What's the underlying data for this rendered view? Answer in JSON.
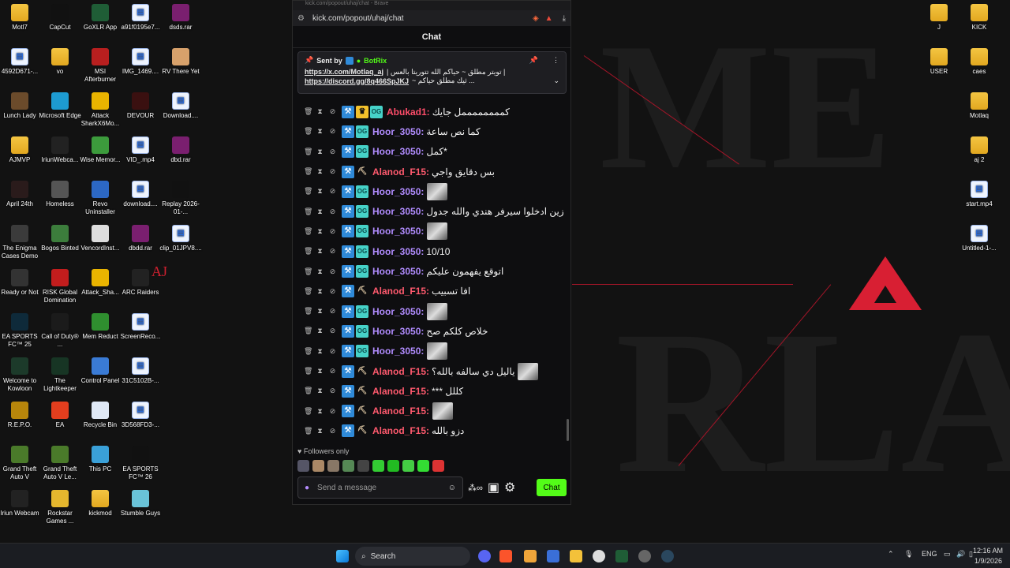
{
  "desktop": {
    "left_icons": [
      {
        "label": "Motl7",
        "kind": "folder"
      },
      {
        "label": "CapCut",
        "kind": "app",
        "color": "#111111"
      },
      {
        "label": "GoXLR App",
        "kind": "app",
        "color": "#1f5d36"
      },
      {
        "label": "a91f0195e7...",
        "kind": "file"
      },
      {
        "label": "dsds.rar",
        "kind": "app",
        "color": "#7a1f6f"
      },
      {
        "label": "4592D671-...",
        "kind": "file"
      },
      {
        "label": "vo",
        "kind": "folder"
      },
      {
        "label": "MSI Afterburner",
        "kind": "app",
        "color": "#b81f1f"
      },
      {
        "label": "IMG_1469....",
        "kind": "file"
      },
      {
        "label": "RV There Yet",
        "kind": "app",
        "color": "#d7a16b"
      },
      {
        "label": "Lunch Lady",
        "kind": "app",
        "color": "#6b4b2b"
      },
      {
        "label": "Microsoft Edge",
        "kind": "app",
        "color": "#1d9bd1"
      },
      {
        "label": "Attack SharkX6Mo...",
        "kind": "app",
        "color": "#e9b400"
      },
      {
        "label": "DEVOUR",
        "kind": "app",
        "color": "#3a1010"
      },
      {
        "label": "Download....",
        "kind": "file"
      },
      {
        "label": "AJMVP",
        "kind": "folder"
      },
      {
        "label": "IriunWebca...",
        "kind": "app",
        "color": "#222222"
      },
      {
        "label": "Wise Memor...",
        "kind": "app",
        "color": "#3c9b3c"
      },
      {
        "label": "VID_.mp4",
        "kind": "file"
      },
      {
        "label": "dbd.rar",
        "kind": "app",
        "color": "#7a1f6f"
      },
      {
        "label": "April 24th",
        "kind": "app",
        "color": "#2a1b1b"
      },
      {
        "label": "Homeless",
        "kind": "app",
        "color": "#555555"
      },
      {
        "label": "Revo Uninstaller",
        "kind": "app",
        "color": "#2c68c4"
      },
      {
        "label": "download....",
        "kind": "file"
      },
      {
        "label": "Replay 2026-01-...",
        "kind": "app",
        "color": "#111111"
      },
      {
        "label": "The Enigma Cases Demo",
        "kind": "app",
        "color": "#3b3b3b"
      },
      {
        "label": "Bogos Binted",
        "kind": "app",
        "color": "#3c7d3c"
      },
      {
        "label": "VencordInst...",
        "kind": "app",
        "color": "#dddddd"
      },
      {
        "label": "dbdd.rar",
        "kind": "app",
        "color": "#7a1f6f"
      },
      {
        "label": "clip_01JPV8....",
        "kind": "file"
      },
      {
        "label": "Ready or Not",
        "kind": "app",
        "color": "#333333"
      },
      {
        "label": "RISK Global Domination",
        "kind": "app",
        "color": "#c21d1d"
      },
      {
        "label": "Attack_Sha...",
        "kind": "app",
        "color": "#e9b400"
      },
      {
        "label": "ARC Raiders",
        "kind": "app",
        "color": "#222222"
      },
      {
        "label": "",
        "kind": "none"
      },
      {
        "label": "EA SPORTS FC™ 25",
        "kind": "app",
        "color": "#0e2a3a"
      },
      {
        "label": "Call of Duty® ...",
        "kind": "app",
        "color": "#1b1b1b"
      },
      {
        "label": "Mem Reduct",
        "kind": "app",
        "color": "#2f8f2f"
      },
      {
        "label": "ScreenReco...",
        "kind": "file"
      },
      {
        "label": "",
        "kind": "none"
      },
      {
        "label": "Welcome to Kowloon",
        "kind": "app",
        "color": "#1c3a2a"
      },
      {
        "label": "The Lightkeeper",
        "kind": "app",
        "color": "#173524"
      },
      {
        "label": "Control Panel",
        "kind": "app",
        "color": "#3a7bd5"
      },
      {
        "label": "31C5102B-...",
        "kind": "file"
      },
      {
        "label": "",
        "kind": "none"
      },
      {
        "label": "R.E.P.O.",
        "kind": "app",
        "color": "#b8860b"
      },
      {
        "label": "EA",
        "kind": "app",
        "color": "#e33e1e"
      },
      {
        "label": "Recycle Bin",
        "kind": "app",
        "color": "#dfe8f5"
      },
      {
        "label": "3D568FD3-...",
        "kind": "file"
      },
      {
        "label": "",
        "kind": "none"
      },
      {
        "label": "Grand Theft Auto V",
        "kind": "app",
        "color": "#4a7a2a"
      },
      {
        "label": "Grand Theft Auto V Le...",
        "kind": "app",
        "color": "#4a7a2a"
      },
      {
        "label": "This PC",
        "kind": "app",
        "color": "#3aa0d8"
      },
      {
        "label": "EA SPORTS FC™ 26",
        "kind": "app",
        "color": "#111111"
      },
      {
        "label": "",
        "kind": "none"
      },
      {
        "label": "Iriun Webcam",
        "kind": "app",
        "color": "#222222"
      },
      {
        "label": "Rockstar Games ...",
        "kind": "app",
        "color": "#e5b72e"
      },
      {
        "label": "kickmod",
        "kind": "folder"
      },
      {
        "label": "Stumble Guys",
        "kind": "app",
        "color": "#69c3d8"
      },
      {
        "label": "",
        "kind": "none"
      }
    ],
    "right_icons": [
      {
        "label": "J",
        "kind": "folder"
      },
      {
        "label": "KICK",
        "kind": "folder"
      },
      {
        "label": "USER",
        "kind": "folder"
      },
      {
        "label": "caes",
        "kind": "folder"
      },
      {
        "label": "",
        "kind": "none"
      },
      {
        "label": "Motlaq",
        "kind": "folder"
      },
      {
        "label": "",
        "kind": "none"
      },
      {
        "label": "aj 2",
        "kind": "folder"
      },
      {
        "label": "",
        "kind": "none"
      },
      {
        "label": "start.mp4",
        "kind": "file"
      },
      {
        "label": "",
        "kind": "none"
      },
      {
        "label": "Untitled-1-...",
        "kind": "file"
      }
    ],
    "wallpaper_mark": "AJ"
  },
  "browser": {
    "title": "kick.com/popout/uhaj/chat - Brave",
    "url": "kick.com/popout/uhaj/chat"
  },
  "chat": {
    "header": "Chat",
    "pinned": {
      "sent_by": "Sent by",
      "bot": "BotRix",
      "line1_link": "https://x.com/Motlaq_aj",
      "line1_text": "| تويتر مطلق ~ حياكم الله تتوريتا بالعس |",
      "line2_link": "https://discord.gg/8q466SpJKJ",
      "line2_text": "~ ثيك مطلق حياكم ..."
    },
    "messages": [
      {
        "user": "Abukad1",
        "color": "#ff4d6a",
        "badges": [
          "mod",
          "crown",
          "og"
        ],
        "text": "كممممممممل جايك"
      },
      {
        "user": "Hoor_3050",
        "color": "#b18cff",
        "badges": [
          "mod",
          "og"
        ],
        "text": "كما نص ساعة"
      },
      {
        "user": "Hoor_3050",
        "color": "#b18cff",
        "badges": [
          "mod",
          "og"
        ],
        "text": "كمل*"
      },
      {
        "user": "Alanod_F15",
        "color": "#ff5a6e",
        "badges": [
          "mod",
          "pick"
        ],
        "text": "بس دقايق واجي"
      },
      {
        "user": "Hoor_3050",
        "color": "#b18cff",
        "badges": [
          "mod",
          "og"
        ],
        "text": "",
        "thumb": true
      },
      {
        "user": "Hoor_3050",
        "color": "#b18cff",
        "badges": [
          "mod",
          "og"
        ],
        "text": "زين ادخلوا سيرفر هندي والله جدول"
      },
      {
        "user": "Hoor_3050",
        "color": "#b18cff",
        "badges": [
          "mod",
          "og"
        ],
        "text": "",
        "thumb": true
      },
      {
        "user": "Hoor_3050",
        "color": "#b18cff",
        "badges": [
          "mod",
          "og"
        ],
        "text": "10/10"
      },
      {
        "user": "Hoor_3050",
        "color": "#b18cff",
        "badges": [
          "mod",
          "og"
        ],
        "text": "اتوقع يفهمون عليكم"
      },
      {
        "user": "Alanod_F15",
        "color": "#ff5a6e",
        "badges": [
          "mod",
          "pick"
        ],
        "text": "افا تسبيب"
      },
      {
        "user": "Hoor_3050",
        "color": "#b18cff",
        "badges": [
          "mod",
          "og"
        ],
        "text": "",
        "thumb": true
      },
      {
        "user": "Hoor_3050",
        "color": "#b18cff",
        "badges": [
          "mod",
          "og"
        ],
        "text": "خلاص كلكم صح"
      },
      {
        "user": "Hoor_3050",
        "color": "#b18cff",
        "badges": [
          "mod",
          "og"
        ],
        "text": "",
        "thumb": true
      },
      {
        "user": "Alanod_F15",
        "color": "#ff5a6e",
        "badges": [
          "mod",
          "pick"
        ],
        "text": "ياليل دي سالفه بالله؟",
        "thumb": true
      },
      {
        "user": "Alanod_F15",
        "color": "#ff5a6e",
        "badges": [
          "mod",
          "pick"
        ],
        "text": "*** كللل"
      },
      {
        "user": "Alanod_F15",
        "color": "#ff5a6e",
        "badges": [
          "mod",
          "pick"
        ],
        "text": "",
        "thumb": true
      },
      {
        "user": "Alanod_F15",
        "color": "#ff5a6e",
        "badges": [
          "mod",
          "pick"
        ],
        "text": "دزو بالله"
      }
    ],
    "followers_only": "Followers only",
    "input_placeholder": "Send a message",
    "send_label": "Chat",
    "accent": "#53fc18"
  },
  "taskbar": {
    "search_label": "Search",
    "language": "ENG",
    "time": "12:16 AM",
    "date": "1/9/2026"
  }
}
